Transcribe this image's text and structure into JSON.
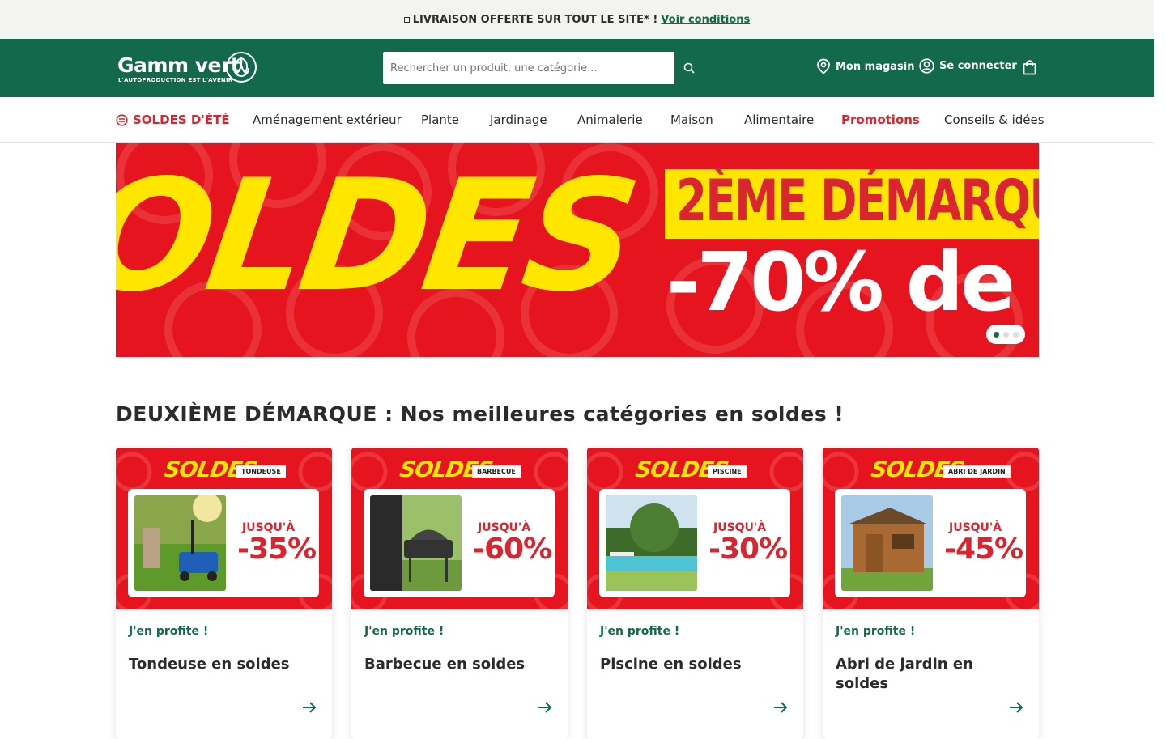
{
  "announcement": {
    "text": "LIVRAISON OFFERTE SUR TOUT LE SITE* !",
    "link": "Voir conditions"
  },
  "header": {
    "logo_text": "Gamm vert",
    "logo_tagline": "L'AUTOPRODUCTION EST L'AVENIR",
    "search_placeholder": "Rechercher un produit, une catégorie...",
    "store_label": "Mon magasin",
    "login_label": "Se connecter"
  },
  "nav": {
    "items": [
      {
        "label": "SOLDES D'ÉTÉ"
      },
      {
        "label": "Aménagement extérieur"
      },
      {
        "label": "Plante"
      },
      {
        "label": "Jardinage"
      },
      {
        "label": "Animalerie"
      },
      {
        "label": "Maison"
      },
      {
        "label": "Alimentaire"
      },
      {
        "label": "Promotions"
      },
      {
        "label": "Conseils & idées"
      }
    ]
  },
  "hero": {
    "word": "OLDES",
    "headline": "2ÈME DÉMARQU",
    "discount": "-70% de",
    "slides": 3,
    "active_slide": 1
  },
  "section": {
    "title": "DEUXIÈME DÉMARQUE : Nos meilleures catégories en soldes !"
  },
  "cards": [
    {
      "badge": "SOLDES",
      "tag": "TONDEUSE",
      "jusqu": "JUSQU'À",
      "discount": "-35%",
      "cta": "J'en profite !",
      "title": "Tondeuse en soldes"
    },
    {
      "badge": "SOLDES",
      "tag": "BARBECUE",
      "jusqu": "JUSQU'À",
      "discount": "-60%",
      "cta": "J'en profite !",
      "title": "Barbecue en soldes"
    },
    {
      "badge": "SOLDES",
      "tag": "PISCINE",
      "jusqu": "JUSQU'À",
      "discount": "-30%",
      "cta": "J'en profite !",
      "title": "Piscine en soldes"
    },
    {
      "badge": "SOLDES",
      "tag": "ABRI DE JARDIN",
      "jusqu": "JUSQU'À",
      "discount": "-45%",
      "cta": "J'en profite !",
      "title": "Abri de jardin en soldes"
    }
  ],
  "colors": {
    "brand_green": "#12694b",
    "sale_red": "#d8252f",
    "banner_red": "#e5141e",
    "banner_yellow": "#ffe600"
  }
}
